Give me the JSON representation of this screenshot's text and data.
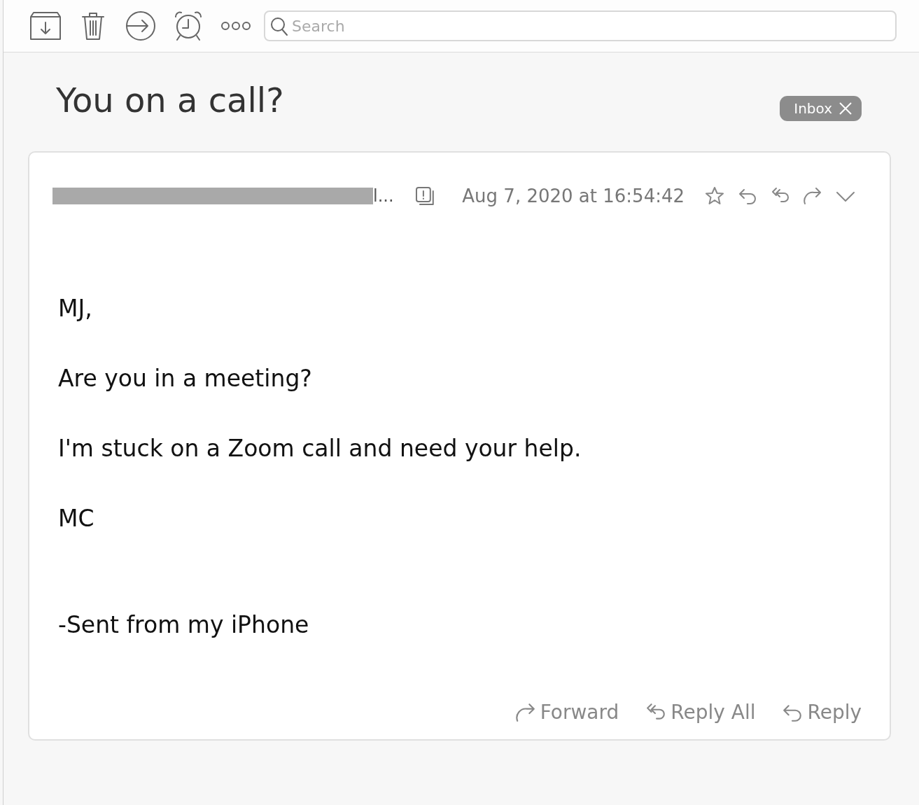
{
  "toolbar": {
    "actions": [
      {
        "kind": "archive"
      },
      {
        "kind": "trash"
      },
      {
        "kind": "move"
      },
      {
        "kind": "snooze"
      },
      {
        "kind": "more"
      }
    ],
    "search": {
      "placeholder": "Search"
    }
  },
  "subject": "You on a call?",
  "tags": [
    {
      "label": "Inbox"
    }
  ],
  "message": {
    "sender": {
      "redacted": true,
      "tail": "l..."
    },
    "date": "Aug 7, 2020 at 16:54:42",
    "header_actions": [
      {
        "kind": "star"
      },
      {
        "kind": "reply"
      },
      {
        "kind": "reply-all"
      },
      {
        "kind": "forward"
      },
      {
        "kind": "expand"
      }
    ],
    "body": [
      {
        "kind": "line",
        "text": "MJ,"
      },
      {
        "kind": "line",
        "text": "Are you in a meeting?"
      },
      {
        "kind": "line",
        "text": "I'm stuck on a Zoom call and need your help."
      },
      {
        "kind": "line",
        "text": "MC"
      },
      {
        "kind": "signature",
        "text": "-Sent from my iPhone"
      }
    ],
    "footer_actions": [
      {
        "kind": "forward",
        "label": "Forward"
      },
      {
        "kind": "reply-all",
        "label": "Reply All"
      },
      {
        "kind": "reply",
        "label": "Reply"
      }
    ]
  }
}
